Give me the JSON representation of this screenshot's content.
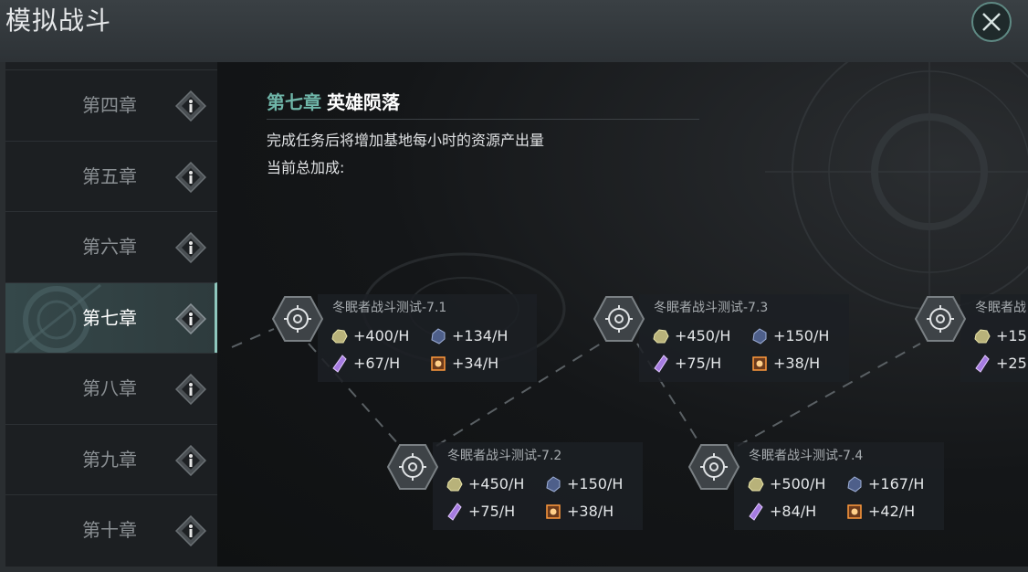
{
  "window": {
    "title": "模拟战斗",
    "close_icon": "close-icon"
  },
  "colors": {
    "accent": "#6fb5a8",
    "active_bar": "#8fc7bd",
    "text_muted": "#8a8f93"
  },
  "sidebar": {
    "items": [
      {
        "label": "第四章",
        "icon": "info-diamond-icon",
        "active": false
      },
      {
        "label": "第五章",
        "icon": "info-diamond-icon",
        "active": false
      },
      {
        "label": "第六章",
        "icon": "info-diamond-icon",
        "active": false
      },
      {
        "label": "第七章",
        "icon": "info-diamond-icon",
        "active": true
      },
      {
        "label": "第八章",
        "icon": "info-diamond-icon",
        "active": false
      },
      {
        "label": "第九章",
        "icon": "info-diamond-icon",
        "active": false
      },
      {
        "label": "第十章",
        "icon": "info-diamond-icon",
        "active": false
      }
    ]
  },
  "chapter": {
    "number": "第七章",
    "name": "英雄陨落",
    "description": "完成任务后将增加基地每小时的资源产出量",
    "bonus_label": "当前总加成:"
  },
  "missions": [
    {
      "name": "冬眠者战斗测试-7.1",
      "ore": "+400/H",
      "gem": "+134/H",
      "crystal": "+67/H",
      "core": "+34/H"
    },
    {
      "name": "冬眠者战斗测试-7.2",
      "ore": "+450/H",
      "gem": "+150/H",
      "crystal": "+75/H",
      "core": "+38/H"
    },
    {
      "name": "冬眠者战斗测试-7.3",
      "ore": "+450/H",
      "gem": "+150/H",
      "crystal": "+75/H",
      "core": "+38/H"
    },
    {
      "name": "冬眠者战斗测试-7.4",
      "ore": "+500/H",
      "gem": "+167/H",
      "crystal": "+84/H",
      "core": "+42/H"
    },
    {
      "name": "冬眠者战",
      "ore": "+15",
      "gem": "",
      "crystal": "+25",
      "core": ""
    }
  ]
}
